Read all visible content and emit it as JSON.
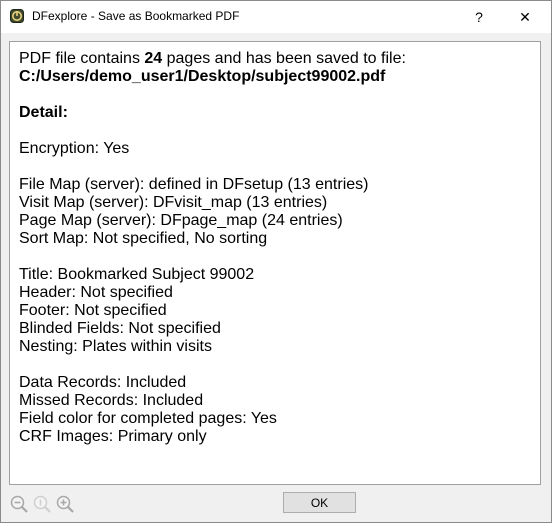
{
  "window": {
    "title": "DFexplore - Save as Bookmarked PDF",
    "help_label": "?",
    "close_label": "✕"
  },
  "message": {
    "intro_prefix": "PDF file contains ",
    "page_count": "24",
    "intro_suffix": " pages and has been saved to file:",
    "file_path": "C:/Users/demo_user1/Desktop/subject99002.pdf",
    "detail_heading": "Detail:",
    "groups": [
      [
        "Encryption: Yes"
      ],
      [
        "File Map (server): defined in DFsetup (13 entries)",
        "Visit Map (server): DFvisit_map (13 entries)",
        "Page Map (server): DFpage_map (24 entries)",
        "Sort Map: Not specified, No sorting"
      ],
      [
        "Title: Bookmarked Subject 99002",
        "Header: Not specified",
        "Footer: Not specified",
        "Blinded Fields: Not specified",
        "Nesting: Plates within visits"
      ],
      [
        "Data Records: Included",
        "Missed Records: Included",
        "Field color for completed pages: Yes",
        "CRF Images: Primary only"
      ]
    ]
  },
  "footer": {
    "ok_label": "OK",
    "icons": [
      "zoom-out-icon",
      "zoom-reset-icon",
      "zoom-in-icon"
    ]
  }
}
